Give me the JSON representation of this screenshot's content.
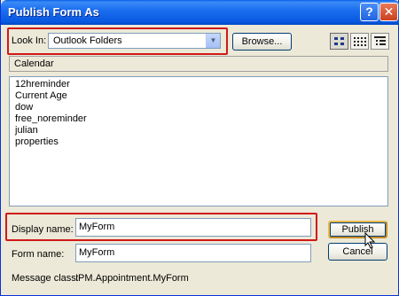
{
  "window": {
    "title": "Publish Form As"
  },
  "look_in": {
    "label": "Look In:",
    "value": "Outlook Folders",
    "icon": "outlook-folder-icon"
  },
  "toolbar": {
    "browse_label": "Browse..."
  },
  "path": "Calendar",
  "forms": [
    "12hreminder",
    "Current Age",
    "dow",
    "free_noreminder",
    "julian",
    "properties"
  ],
  "display_name": {
    "label": "Display name:",
    "value": "MyForm"
  },
  "form_name": {
    "label": "Form name:",
    "value": "MyForm"
  },
  "message_class": {
    "label": "Message class:",
    "value": "IPM.Appointment.MyForm"
  },
  "buttons": {
    "publish": "Publish",
    "cancel": "Cancel"
  },
  "colors": {
    "highlight": "#d11919",
    "titlebar": "#0858e0"
  }
}
